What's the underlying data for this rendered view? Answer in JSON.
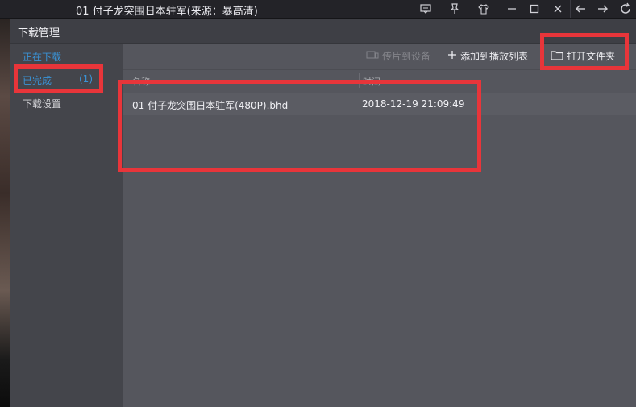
{
  "window": {
    "title": "01 付子龙突围日本驻军(来源：暴高清)",
    "icons": [
      "feedback-icon",
      "pin-icon",
      "skin-icon",
      "minimize-icon",
      "maximize-icon",
      "close-icon",
      "back-icon",
      "forward-icon",
      "refresh-icon"
    ]
  },
  "dialog": {
    "title": "下载管理"
  },
  "sidebar": {
    "items": [
      {
        "label": "正在下载",
        "active": true
      },
      {
        "label": "已完成",
        "count": "(1)",
        "active": true
      },
      {
        "label": "下载设置",
        "active": false
      }
    ]
  },
  "toolbar": {
    "send_label": "传片到设备",
    "add_label": "添加到播放列表",
    "open_folder_label": "打开文件夹"
  },
  "table": {
    "headers": [
      "名称",
      "时间"
    ],
    "rows": [
      {
        "name": "01 付子龙突围日本驻军(480P).bhd",
        "time": "2018-12-19 21:09:49"
      }
    ]
  },
  "colors": {
    "accent": "#3a93d6",
    "annotation": "#e8353a"
  }
}
